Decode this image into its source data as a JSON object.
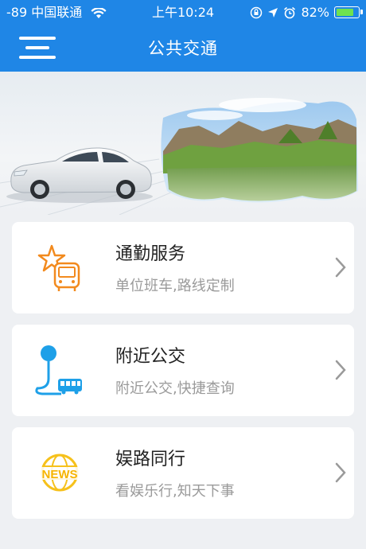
{
  "status_bar": {
    "signal": "-89 中国联通",
    "time": "上午10:24",
    "battery_percent": "82%",
    "battery_level": 0.82
  },
  "nav": {
    "title": "公共交通"
  },
  "cards": [
    {
      "title": "通勤服务",
      "subtitle": "单位班车,路线定制",
      "icon": "star-bus-icon"
    },
    {
      "title": "附近公交",
      "subtitle": "附近公交,快捷查询",
      "icon": "map-pin-bus-icon"
    },
    {
      "title": "娱路同行",
      "subtitle": "看娱乐行,知天下事",
      "icon": "news-icon",
      "icon_text": "NEWS"
    }
  ],
  "colors": {
    "primary": "#1f86e6",
    "orange": "#f28a1e",
    "news_yellow": "#f6c11b",
    "blue_icon": "#1ea0e8"
  }
}
